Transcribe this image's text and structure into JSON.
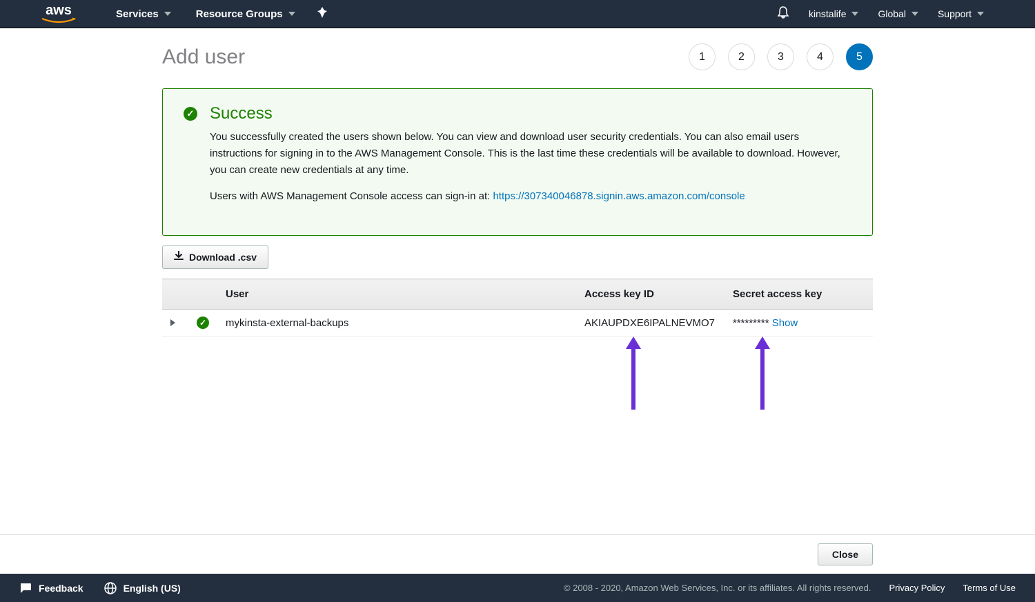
{
  "topnav": {
    "services": "Services",
    "resource_groups": "Resource Groups",
    "account": "kinstalife",
    "region": "Global",
    "support": "Support"
  },
  "page": {
    "title": "Add user",
    "steps": [
      "1",
      "2",
      "3",
      "4",
      "5"
    ],
    "active_step_index": 4
  },
  "alert": {
    "title": "Success",
    "body1": "You successfully created the users shown below. You can view and download user security credentials. You can also email users instructions for signing in to the AWS Management Console. This is the last time these credentials will be available to download. However, you can create new credentials at any time.",
    "body2_prefix": "Users with AWS Management Console access can sign-in at: ",
    "signin_url": "https://307340046878.signin.aws.amazon.com/console"
  },
  "download_btn": "Download .csv",
  "table": {
    "headers": {
      "user": "User",
      "access_key_id": "Access key ID",
      "secret_access_key": "Secret access key"
    },
    "rows": [
      {
        "user": "mykinsta-external-backups",
        "access_key_id": "AKIAUPDXE6IPALNEVMO7",
        "secret_masked": "*********",
        "show_label": "Show"
      }
    ]
  },
  "close_btn": "Close",
  "footer": {
    "feedback": "Feedback",
    "language": "English (US)",
    "copyright": "© 2008 - 2020, Amazon Web Services, Inc. or its affiliates. All rights reserved.",
    "privacy": "Privacy Policy",
    "terms": "Terms of Use"
  }
}
